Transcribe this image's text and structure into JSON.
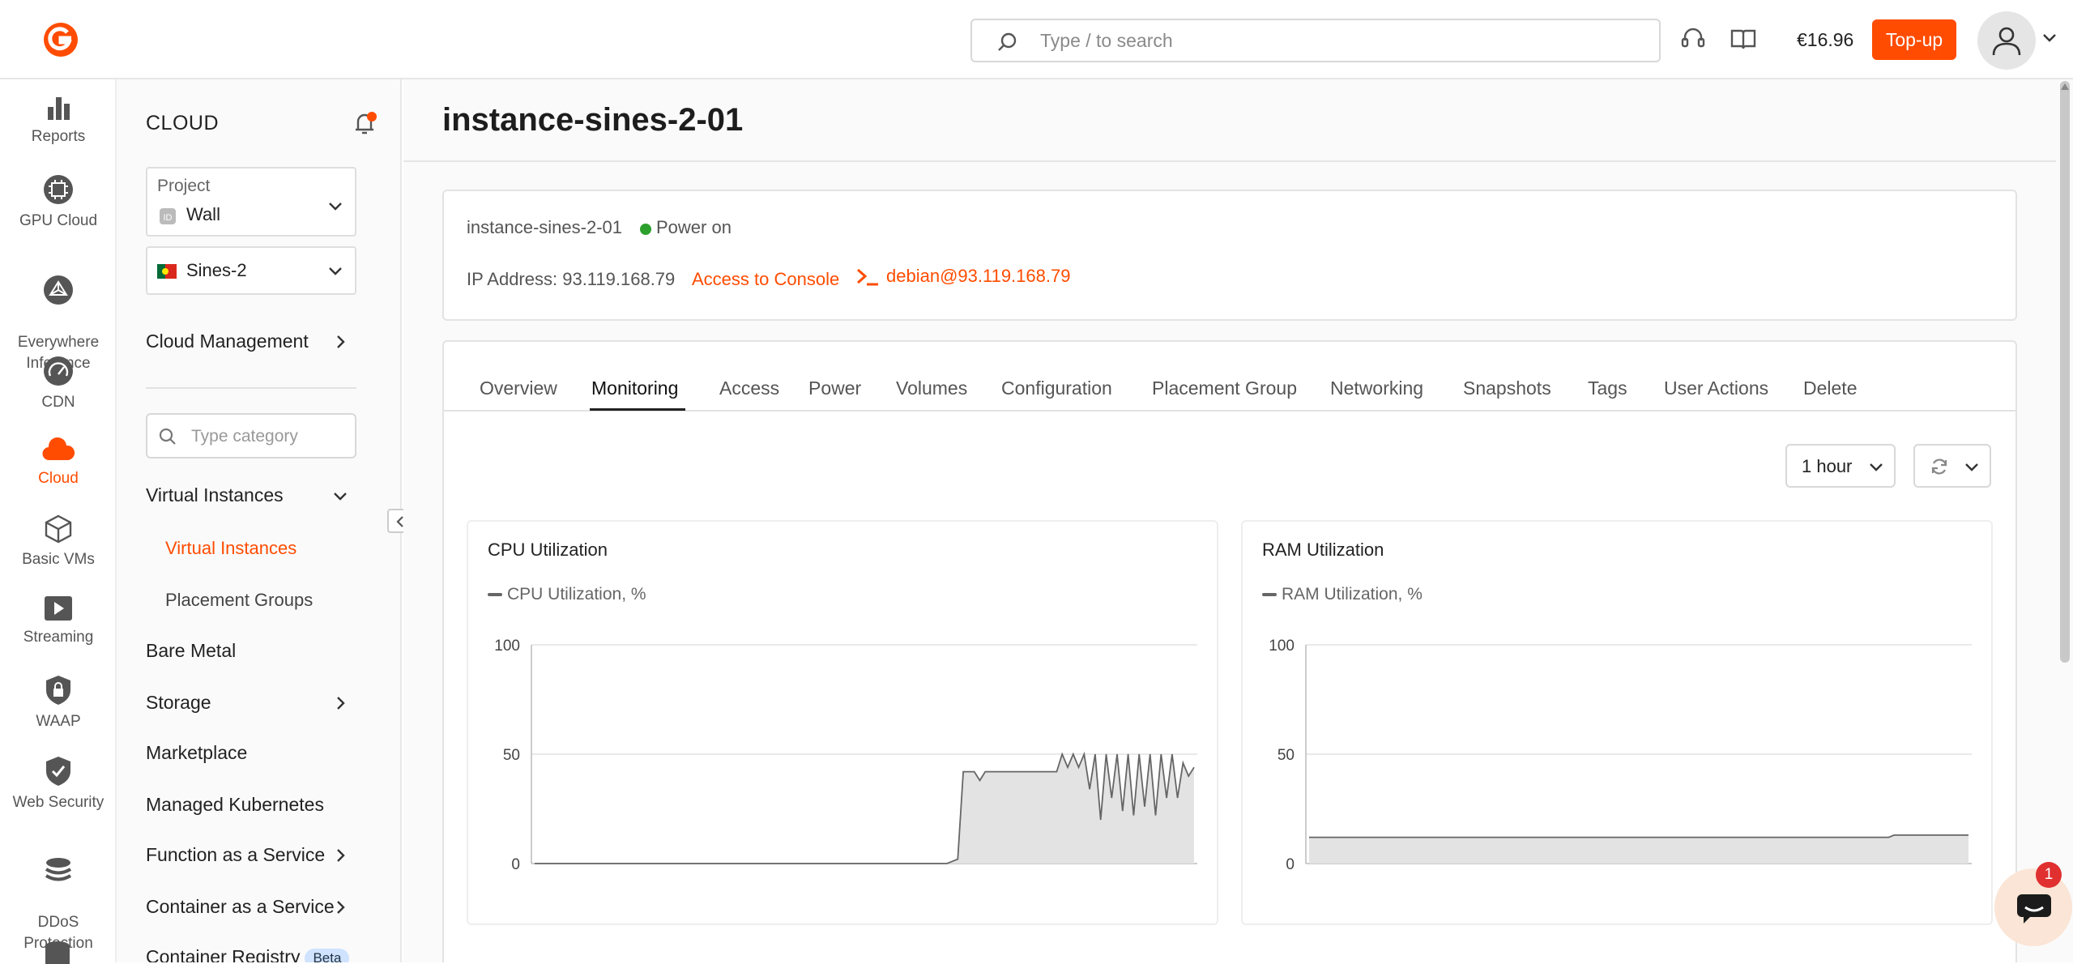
{
  "topbar": {
    "search_placeholder": "Type / to search",
    "balance": "€16.96",
    "topup_label": "Top-up"
  },
  "rail": {
    "items": [
      {
        "label": "Reports",
        "icon": "bar-chart-icon"
      },
      {
        "label": "GPU Cloud",
        "icon": "chip-icon"
      },
      {
        "label": "Everywhere\nInference",
        "icon": "network-icon"
      },
      {
        "label": "CDN",
        "icon": "speedometer-icon"
      },
      {
        "label": "Cloud",
        "icon": "cloud-icon",
        "active": true
      },
      {
        "label": "Basic VMs",
        "icon": "cube-icon"
      },
      {
        "label": "Streaming",
        "icon": "play-icon"
      },
      {
        "label": "WAAP",
        "icon": "shield-lock-icon"
      },
      {
        "label": "Web Security",
        "icon": "shield-check-icon"
      },
      {
        "label": "DDoS\nProtection",
        "icon": "layers-icon"
      }
    ]
  },
  "nav": {
    "title": "CLOUD",
    "project_label": "Project",
    "project_value": "Wall",
    "region_value": "Sines-2",
    "cloud_management": "Cloud Management",
    "category_placeholder": "Type category",
    "virtual_instances": "Virtual Instances",
    "sub_virtual_instances": "Virtual Instances",
    "sub_placement_groups": "Placement Groups",
    "bare_metal": "Bare Metal",
    "storage": "Storage",
    "marketplace": "Marketplace",
    "managed_kubernetes": "Managed Kubernetes",
    "faas": "Function as a Service",
    "caas": "Container as a Service",
    "container_registry": "Container Registry",
    "beta": "Beta"
  },
  "main": {
    "title": "instance-sines-2-01",
    "info": {
      "name": "instance-sines-2-01",
      "power": "Power on",
      "ip": "IP Address: 93.119.168.79",
      "console": "Access to Console",
      "ssh": "debian@93.119.168.79"
    },
    "tabs": [
      "Overview",
      "Monitoring",
      "Access",
      "Power",
      "Volumes",
      "Configuration",
      "Placement Group",
      "Networking",
      "Snapshots",
      "Tags",
      "User Actions",
      "Delete"
    ],
    "active_tab": "Monitoring",
    "range": "1 hour",
    "chat_badge": "1"
  },
  "colors": {
    "accent": "#ff4c00",
    "power_on": "#2ca02c"
  },
  "chart_data": [
    {
      "type": "area",
      "title": "CPU Utilization",
      "series": [
        {
          "name": "CPU Utilization, %",
          "values": [
            0,
            0,
            0,
            0,
            0,
            0,
            0,
            0,
            0,
            0,
            0,
            0,
            0,
            0,
            0,
            0,
            0,
            0,
            0,
            0,
            0,
            0,
            0,
            0,
            0,
            0,
            0,
            0,
            0,
            0,
            0,
            0,
            0,
            0,
            0,
            0,
            0,
            0,
            0,
            0,
            0,
            0,
            0,
            0,
            0,
            0,
            0,
            0,
            0,
            0,
            0,
            0,
            0,
            0,
            0,
            0,
            0,
            0,
            0,
            0,
            0,
            0,
            0,
            0,
            0,
            0,
            0,
            0,
            0,
            0,
            0,
            0,
            0,
            0,
            0,
            0,
            1,
            2,
            42,
            42,
            42,
            38,
            42,
            42,
            42,
            42,
            42,
            42,
            42,
            42,
            42,
            42,
            42,
            42,
            42,
            42,
            50,
            44,
            50,
            44,
            50,
            34,
            50,
            20,
            50,
            30,
            50,
            24,
            50,
            22,
            50,
            26,
            50,
            22,
            50,
            30,
            50,
            30,
            46,
            40,
            44
          ]
        }
      ],
      "yticks": [
        0,
        50,
        100
      ],
      "ylim": [
        0,
        100
      ],
      "grid": true
    },
    {
      "type": "area",
      "title": "RAM Utilization",
      "series": [
        {
          "name": "RAM Utilization, %",
          "values": [
            12,
            12,
            12,
            12,
            12,
            12,
            12,
            12,
            12,
            12,
            12,
            12,
            12,
            12,
            12,
            12,
            12,
            12,
            12,
            12,
            12,
            12,
            12,
            12,
            12,
            12,
            12,
            12,
            12,
            12,
            12,
            12,
            12,
            12,
            12,
            12,
            12,
            12,
            12,
            12,
            12,
            12,
            12,
            12,
            12,
            12,
            12,
            12,
            12,
            12,
            12,
            12,
            12,
            12,
            12,
            12,
            12,
            12,
            12,
            12,
            12,
            12,
            12,
            12,
            12,
            12,
            12,
            12,
            12,
            12,
            12,
            12,
            12,
            12,
            12,
            12,
            12,
            12,
            12,
            12,
            12,
            12,
            12,
            12,
            12,
            12,
            12,
            12,
            12,
            12,
            12,
            12,
            12,
            12,
            12,
            12,
            12,
            12,
            12,
            12,
            12,
            12,
            12,
            12,
            12,
            12,
            12,
            12,
            12,
            12,
            13,
            13,
            13,
            13,
            13,
            13,
            13,
            13,
            13,
            13,
            13,
            13,
            13,
            13,
            13
          ]
        }
      ],
      "yticks": [
        0,
        50,
        100
      ],
      "ylim": [
        0,
        100
      ],
      "grid": true
    }
  ]
}
